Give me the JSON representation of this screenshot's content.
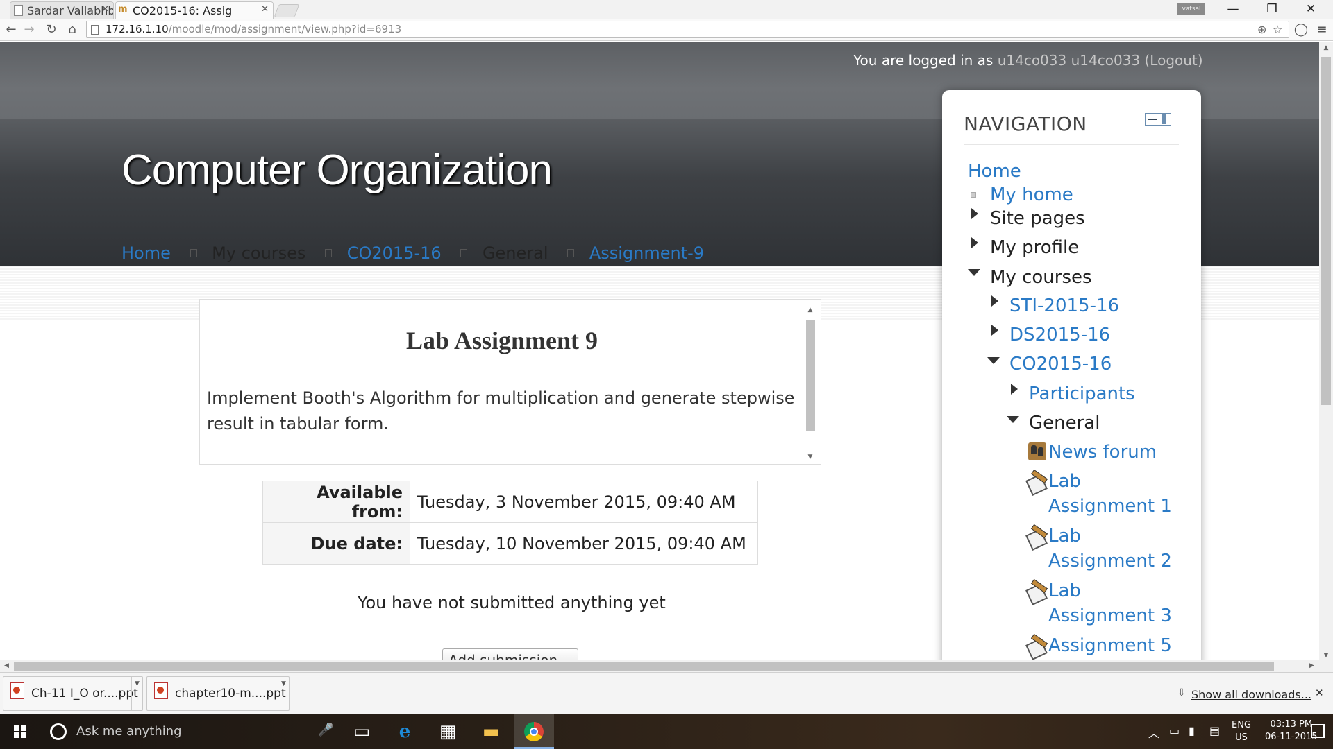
{
  "browser": {
    "tabs": [
      {
        "title": "Sardar Vallabhbha",
        "active": false
      },
      {
        "title": "CO2015-16: Assig",
        "active": true
      }
    ],
    "user_chip": "vatsal",
    "url_host": "172.16.1.10",
    "url_path": "/moodle/mod/assignment/view.php?id=6913",
    "window_controls": [
      "minimize-icon",
      "restore-icon",
      "close-icon"
    ]
  },
  "header": {
    "login_prefix": "You are logged in as",
    "username": "u14co033 u14co033",
    "logout_open": "(",
    "logout": "Logout",
    "logout_close": ")",
    "site_title": "Computer Organization"
  },
  "breadcrumb": [
    {
      "label": "Home",
      "link": true
    },
    {
      "label": "My courses",
      "link": false
    },
    {
      "label": "CO2015-16",
      "link": true
    },
    {
      "label": "General",
      "link": false
    },
    {
      "label": "Assignment-9",
      "link": true
    }
  ],
  "assignment": {
    "title": "Lab Assignment 9",
    "description": "Implement Booth's Algorithm for multiplication and generate stepwise result in tabular form.",
    "available_label": "Available from:",
    "available_value": "Tuesday, 3 November 2015, 09:40 AM",
    "due_label": "Due date:",
    "due_value": "Tuesday, 10 November 2015, 09:40 AM",
    "status": "You have not submitted anything yet",
    "add_button": "Add submission"
  },
  "navigation": {
    "heading": "NAVIGATION",
    "items": [
      {
        "label": "Home",
        "link": true
      },
      {
        "label": "My home",
        "link": true
      },
      {
        "label": "Site pages",
        "link": false
      },
      {
        "label": "My profile",
        "link": false
      },
      {
        "label": "My courses",
        "link": false
      },
      {
        "label": "STI-2015-16",
        "link": true
      },
      {
        "label": "DS2015-16",
        "link": true
      },
      {
        "label": "CO2015-16",
        "link": true
      },
      {
        "label": "Participants",
        "link": true
      },
      {
        "label": "General",
        "link": false
      },
      {
        "label": "News forum",
        "link": true
      },
      {
        "label": "Lab",
        "label2": "Assignment 1",
        "link": true
      },
      {
        "label": "Lab",
        "label2": "Assignment 2",
        "link": true
      },
      {
        "label": "Lab",
        "label2": "Assignment 3",
        "link": true
      },
      {
        "label": "Assignment 5",
        "link": true
      }
    ]
  },
  "downloads": {
    "items": [
      "Ch-11 I_O or....ppt",
      "chapter10-m....ppt"
    ],
    "show_all": "Show all downloads..."
  },
  "taskbar": {
    "search_placeholder": "Ask me anything",
    "lang_line1": "ENG",
    "lang_line2": "US",
    "time": "03:13 PM",
    "date": "06-11-2015"
  }
}
